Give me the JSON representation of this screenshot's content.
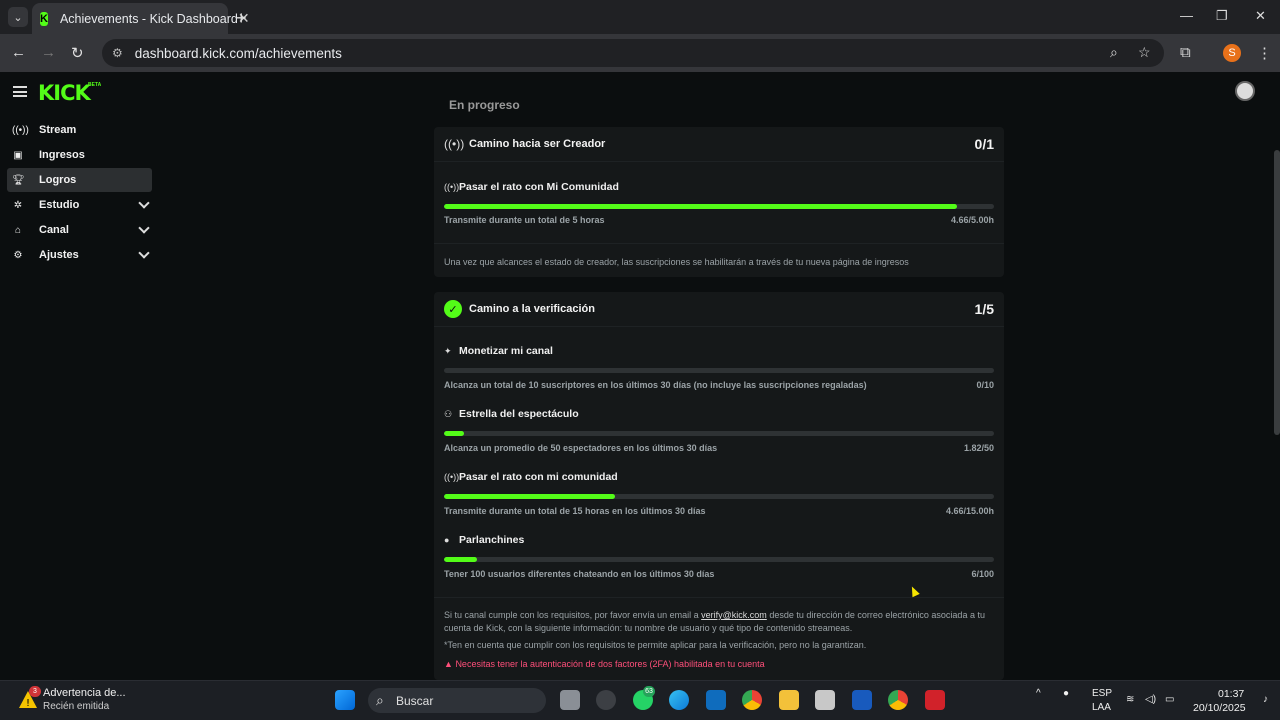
{
  "browser": {
    "tab_title": "Achievements - Kick Dashboard",
    "url": "dashboard.kick.com/achievements",
    "profile_initial": "S"
  },
  "header": {
    "logo": "KICK",
    "logo_badge": "BETA"
  },
  "sidebar": {
    "items": [
      {
        "label": "Stream",
        "icon": "broadcast-icon"
      },
      {
        "label": "Ingresos",
        "icon": "wallet-icon"
      },
      {
        "label": "Logros",
        "icon": "trophy-icon",
        "active": true
      },
      {
        "label": "Estudio",
        "icon": "studio-icon",
        "expandable": true
      },
      {
        "label": "Canal",
        "icon": "channel-icon",
        "expandable": true
      },
      {
        "label": "Ajustes",
        "icon": "gear-icon",
        "expandable": true
      }
    ]
  },
  "main": {
    "section_heading": "En progreso",
    "creator": {
      "title": "Camino hacia ser Creador",
      "count": "0/1",
      "goals": [
        {
          "title": "Pasar el rato con Mi Comunidad",
          "desc": "Transmite durante un total de 5 horas",
          "value": "4.66/5.00h",
          "progress": 0.932
        }
      ],
      "note": "Una vez que alcances el estado de creador, las suscripciones se habilitarán a través de tu nueva página de ingresos"
    },
    "verification": {
      "title": "Camino a la verificación",
      "count": "1/5",
      "goals": [
        {
          "title": "Monetizar mi canal",
          "desc": "Alcanza un total de 10 suscriptores en los últimos 30 días (no incluye las suscripciones regaladas)",
          "value": "0/10",
          "progress": 0.0
        },
        {
          "title": "Estrella del espectáculo",
          "desc": "Alcanza un promedio de 50 espectadores en los últimos 30 días",
          "value": "1.82/50",
          "progress": 0.036
        },
        {
          "title": "Pasar el rato con mi comunidad",
          "desc": "Transmite durante un total de 15 horas en los últimos 30 días",
          "value": "4.66/15.00h",
          "progress": 0.31
        },
        {
          "title": "Parlanchines",
          "desc": "Tener 100 usuarios diferentes chateando en los últimos 30 días",
          "value": "6/100",
          "progress": 0.06
        }
      ],
      "note_pre": "Si tu canal cumple con los requisitos, por favor envía un email a",
      "note_email": "verify@kick.com",
      "note_post": "desde tu dirección de correo electrónico asociada a tu cuenta de Kick, con la siguiente información: tu nombre de usuario y qué tipo de contenido streameas.",
      "note2": "*Ten en cuenta que cumplir con los requisitos te permite aplicar para la verificación, pero no la garantizan.",
      "warning": "Necesitas tener la autenticación de dos factores (2FA) habilitada en tu cuenta"
    }
  },
  "taskbar": {
    "notification_title": "Advertencia de...",
    "notification_sub": "Recién emitida",
    "notification_badge": "3",
    "search_label": "Buscar",
    "whatsapp_badge": "63",
    "lang_top": "ESP",
    "lang_bottom": "LAA",
    "time": "01:37",
    "date": "20/10/2025"
  }
}
